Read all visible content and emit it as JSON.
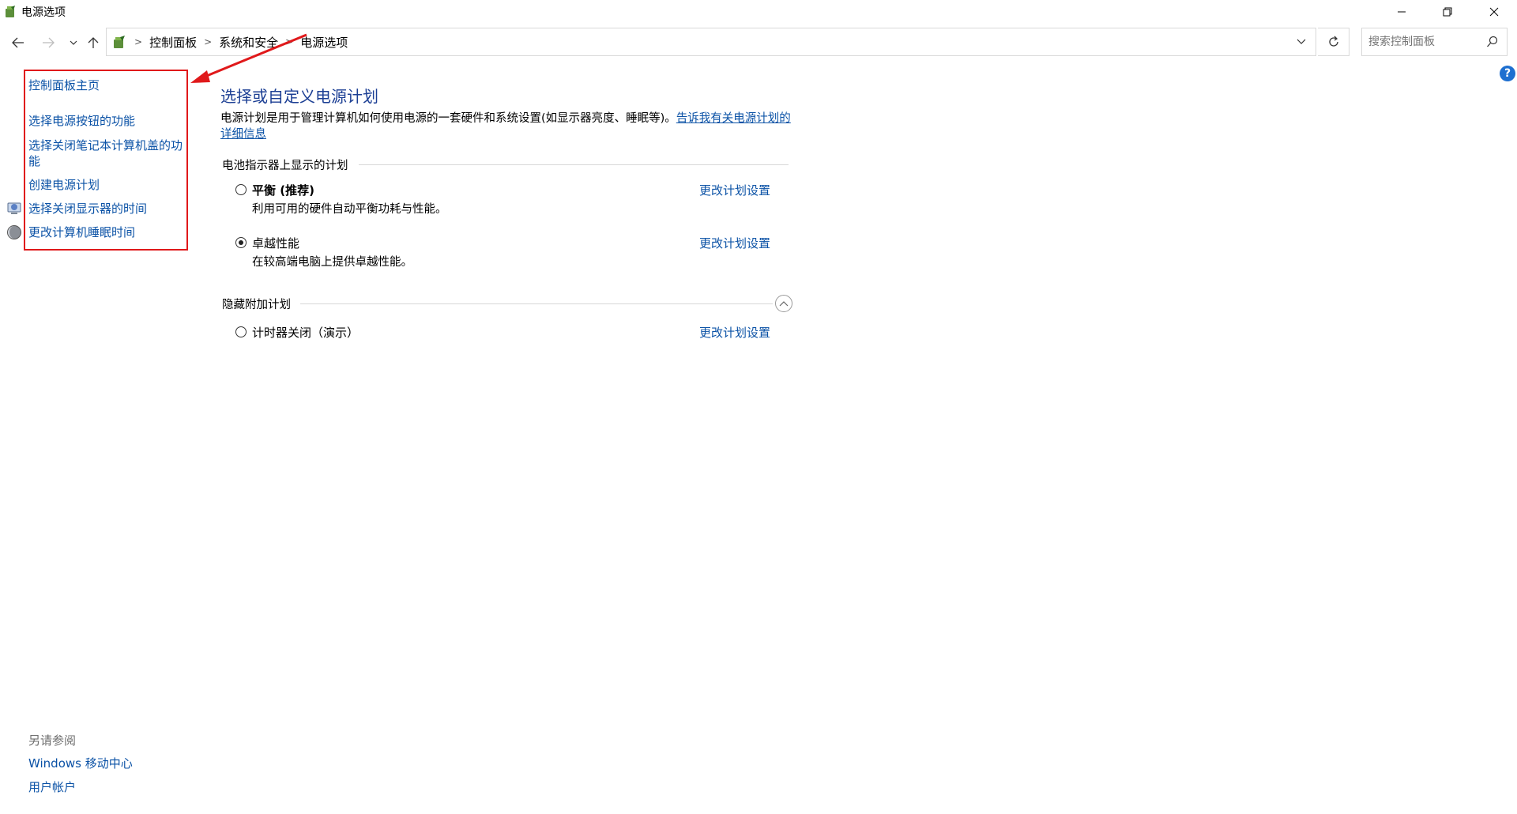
{
  "window": {
    "title": "电源选项"
  },
  "navigation": {
    "breadcrumbs": [
      "控制面板",
      "系统和安全",
      "电源选项"
    ],
    "search_placeholder": "搜索控制面板"
  },
  "left_pane": {
    "home_link": "控制面板主页",
    "tasks": [
      {
        "label": "选择电源按钮的功能"
      },
      {
        "label": "选择关闭笔记本计算机盖的功能"
      },
      {
        "label": "创建电源计划"
      },
      {
        "label": "选择关闭显示器的时间",
        "icon": "display-icon"
      },
      {
        "label": "更改计算机睡眠时间",
        "icon": "sleep-icon"
      }
    ],
    "see_also": {
      "title": "另请参阅",
      "links": [
        "Windows 移动中心",
        "用户帐户"
      ]
    }
  },
  "main": {
    "title": "选择或自定义电源计划",
    "intro_text": "电源计划是用于管理计算机如何使用电源的一套硬件和系统设置(如显示器亮度、睡眠等)。",
    "intro_link": "告诉我有关电源计划的详细信息",
    "battery_group_title": "电池指示器上显示的计划",
    "hidden_group_title": "隐藏附加计划",
    "plans": [
      {
        "name": "平衡 (推荐)",
        "description": "利用可用的硬件自动平衡功耗与性能。",
        "selected": false,
        "link": "更改计划设置"
      },
      {
        "name": "卓越性能",
        "description": "在较高端电脑上提供卓越性能。",
        "selected": true,
        "link": "更改计划设置"
      }
    ],
    "hidden_plans": [
      {
        "name": "计时器关闭（演示）",
        "selected": false,
        "link": "更改计划设置"
      }
    ]
  },
  "colors": {
    "link": "#0b52a6",
    "title": "#1c3f94",
    "highlight": "#e0191b"
  }
}
